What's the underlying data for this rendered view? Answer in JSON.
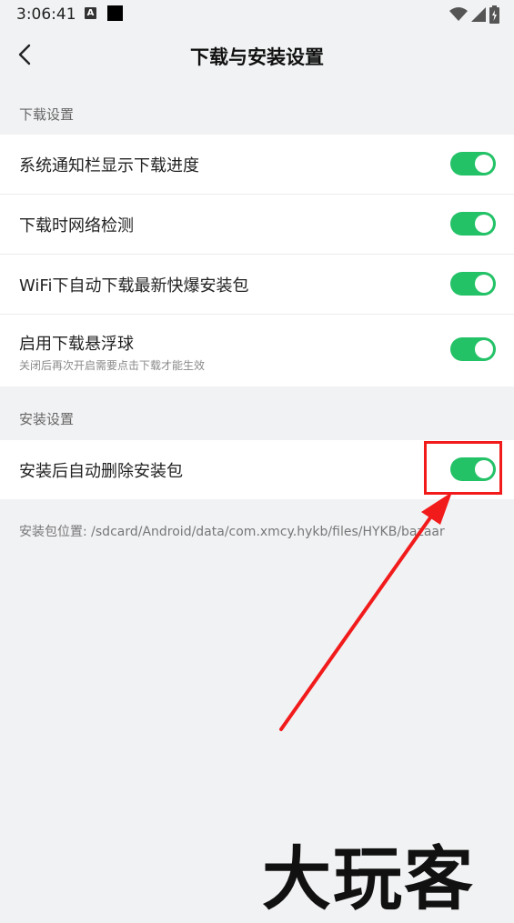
{
  "status_bar": {
    "time": "3:06:41",
    "icons": [
      "a-notification-icon",
      "square-notification-icon",
      "wifi-icon",
      "signal-icon",
      "battery-charging-icon"
    ]
  },
  "header": {
    "title": "下载与安装设置",
    "back_icon": "chevron-left-icon"
  },
  "download_section": {
    "title": "下载设置",
    "items": [
      {
        "label": "系统通知栏显示下载进度",
        "enabled": true
      },
      {
        "label": "下载时网络检测",
        "enabled": true
      },
      {
        "label": "WiFi下自动下载最新快爆安装包",
        "enabled": true
      },
      {
        "label": "启用下载悬浮球",
        "sublabel": "关闭后再次开启需要点击下载才能生效",
        "enabled": true
      }
    ]
  },
  "install_section": {
    "title": "安装设置",
    "items": [
      {
        "label": "安装后自动删除安装包",
        "enabled": true
      }
    ]
  },
  "path_note": "安装包位置: /sdcard/Android/data/com.xmcy.hykb/files/HYKB/bazaar",
  "watermark": "大玩客",
  "colors": {
    "toggle_on": "#23c267",
    "annotation": "#f21b1b",
    "background": "#f1f2f4"
  }
}
